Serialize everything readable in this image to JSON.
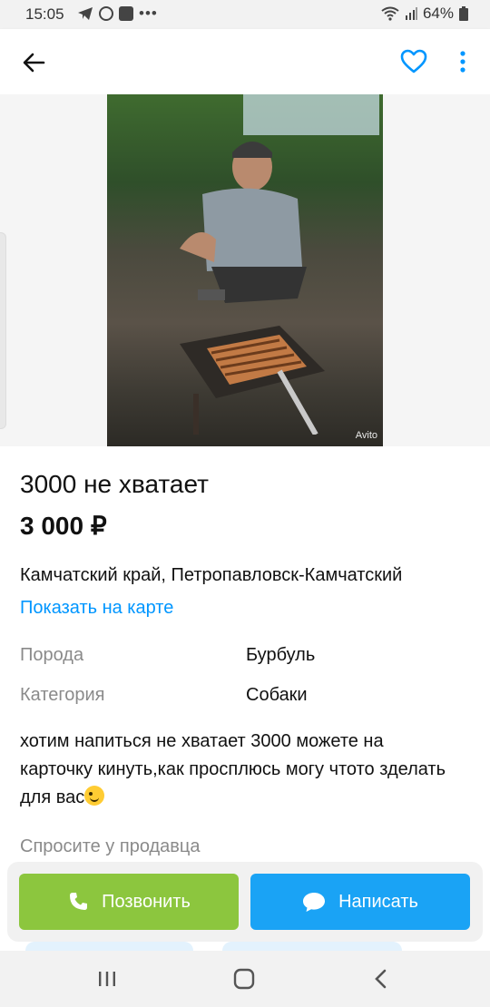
{
  "status_bar": {
    "time": "15:05",
    "battery": "64%"
  },
  "header": {
    "back_icon": "arrow-left-icon",
    "favorite_icon": "heart-outline-icon",
    "more_icon": "more-vertical-icon"
  },
  "gallery": {
    "watermark": "Avito"
  },
  "listing": {
    "title": "3000 не хватает",
    "price": "3 000 ₽",
    "location": "Камчатский край, Петропавловск-Камчатский",
    "map_link": "Показать на карте",
    "properties": [
      {
        "key": "Порода",
        "value": "Бурбуль"
      },
      {
        "key": "Категория",
        "value": "Собаки"
      }
    ],
    "description": "хотим напиться не хватает 3000 можете на карточку кинуть,как просплюсь могу чтото зделать для вас",
    "ask_seller": "Спросите у продавца"
  },
  "actions": {
    "call_label": "Позвонить",
    "write_label": "Написать",
    "call_color": "#8cc63e",
    "write_color": "#1aa3f5"
  },
  "colors": {
    "accent": "#0096ff"
  }
}
